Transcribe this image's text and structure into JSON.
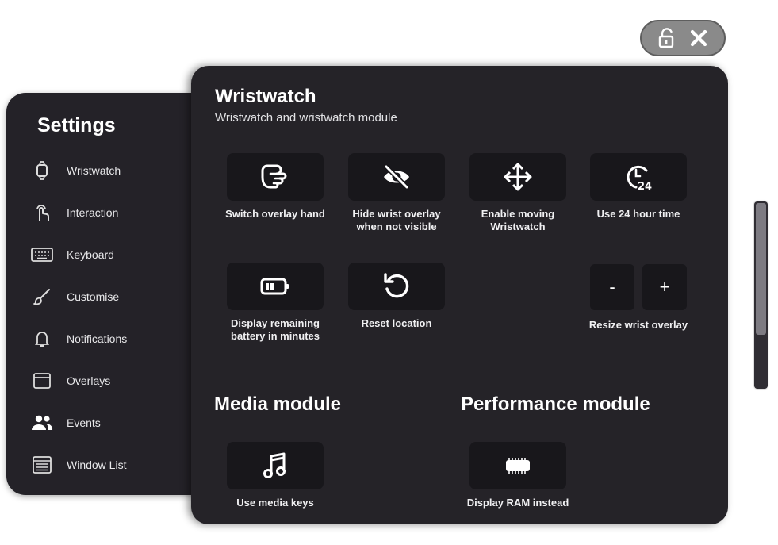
{
  "sidebar": {
    "title": "Settings",
    "items": [
      {
        "label": "Wristwatch",
        "icon": "watch-icon"
      },
      {
        "label": "Interaction",
        "icon": "pointer-hand-icon"
      },
      {
        "label": "Keyboard",
        "icon": "keyboard-icon"
      },
      {
        "label": "Customise",
        "icon": "brush-icon"
      },
      {
        "label": "Notifications",
        "icon": "bell-icon"
      },
      {
        "label": "Overlays",
        "icon": "window-icon"
      },
      {
        "label": "Events",
        "icon": "people-icon"
      },
      {
        "label": "Window List",
        "icon": "window-list-icon"
      }
    ]
  },
  "topbar": {
    "lock_icon": "unlock-icon",
    "close_icon": "close-icon"
  },
  "wristwatch": {
    "title": "Wristwatch",
    "subtitle": "Wristwatch and wristwatch module",
    "options": [
      {
        "label": "Switch overlay hand",
        "icon": "hand-swap-icon"
      },
      {
        "label": "Hide wrist overlay\nwhen not visible",
        "icon": "eye-off-icon"
      },
      {
        "label": "Enable moving\nWristwatch",
        "icon": "move-arrows-icon"
      },
      {
        "label": "Use 24 hour time",
        "icon": "clock-24-icon"
      },
      {
        "label": "Display remaining\nbattery in minutes",
        "icon": "battery-icon"
      },
      {
        "label": "Reset location",
        "icon": "reset-icon"
      }
    ],
    "resize": {
      "minus": "-",
      "plus": "+",
      "label": "Resize wrist overlay"
    }
  },
  "media": {
    "title": "Media module",
    "options": [
      {
        "label": "Use media keys",
        "icon": "music-note-icon"
      }
    ]
  },
  "performance": {
    "title": "Performance module",
    "options": [
      {
        "label": "Display RAM instead",
        "icon": "ram-chip-icon"
      }
    ]
  }
}
